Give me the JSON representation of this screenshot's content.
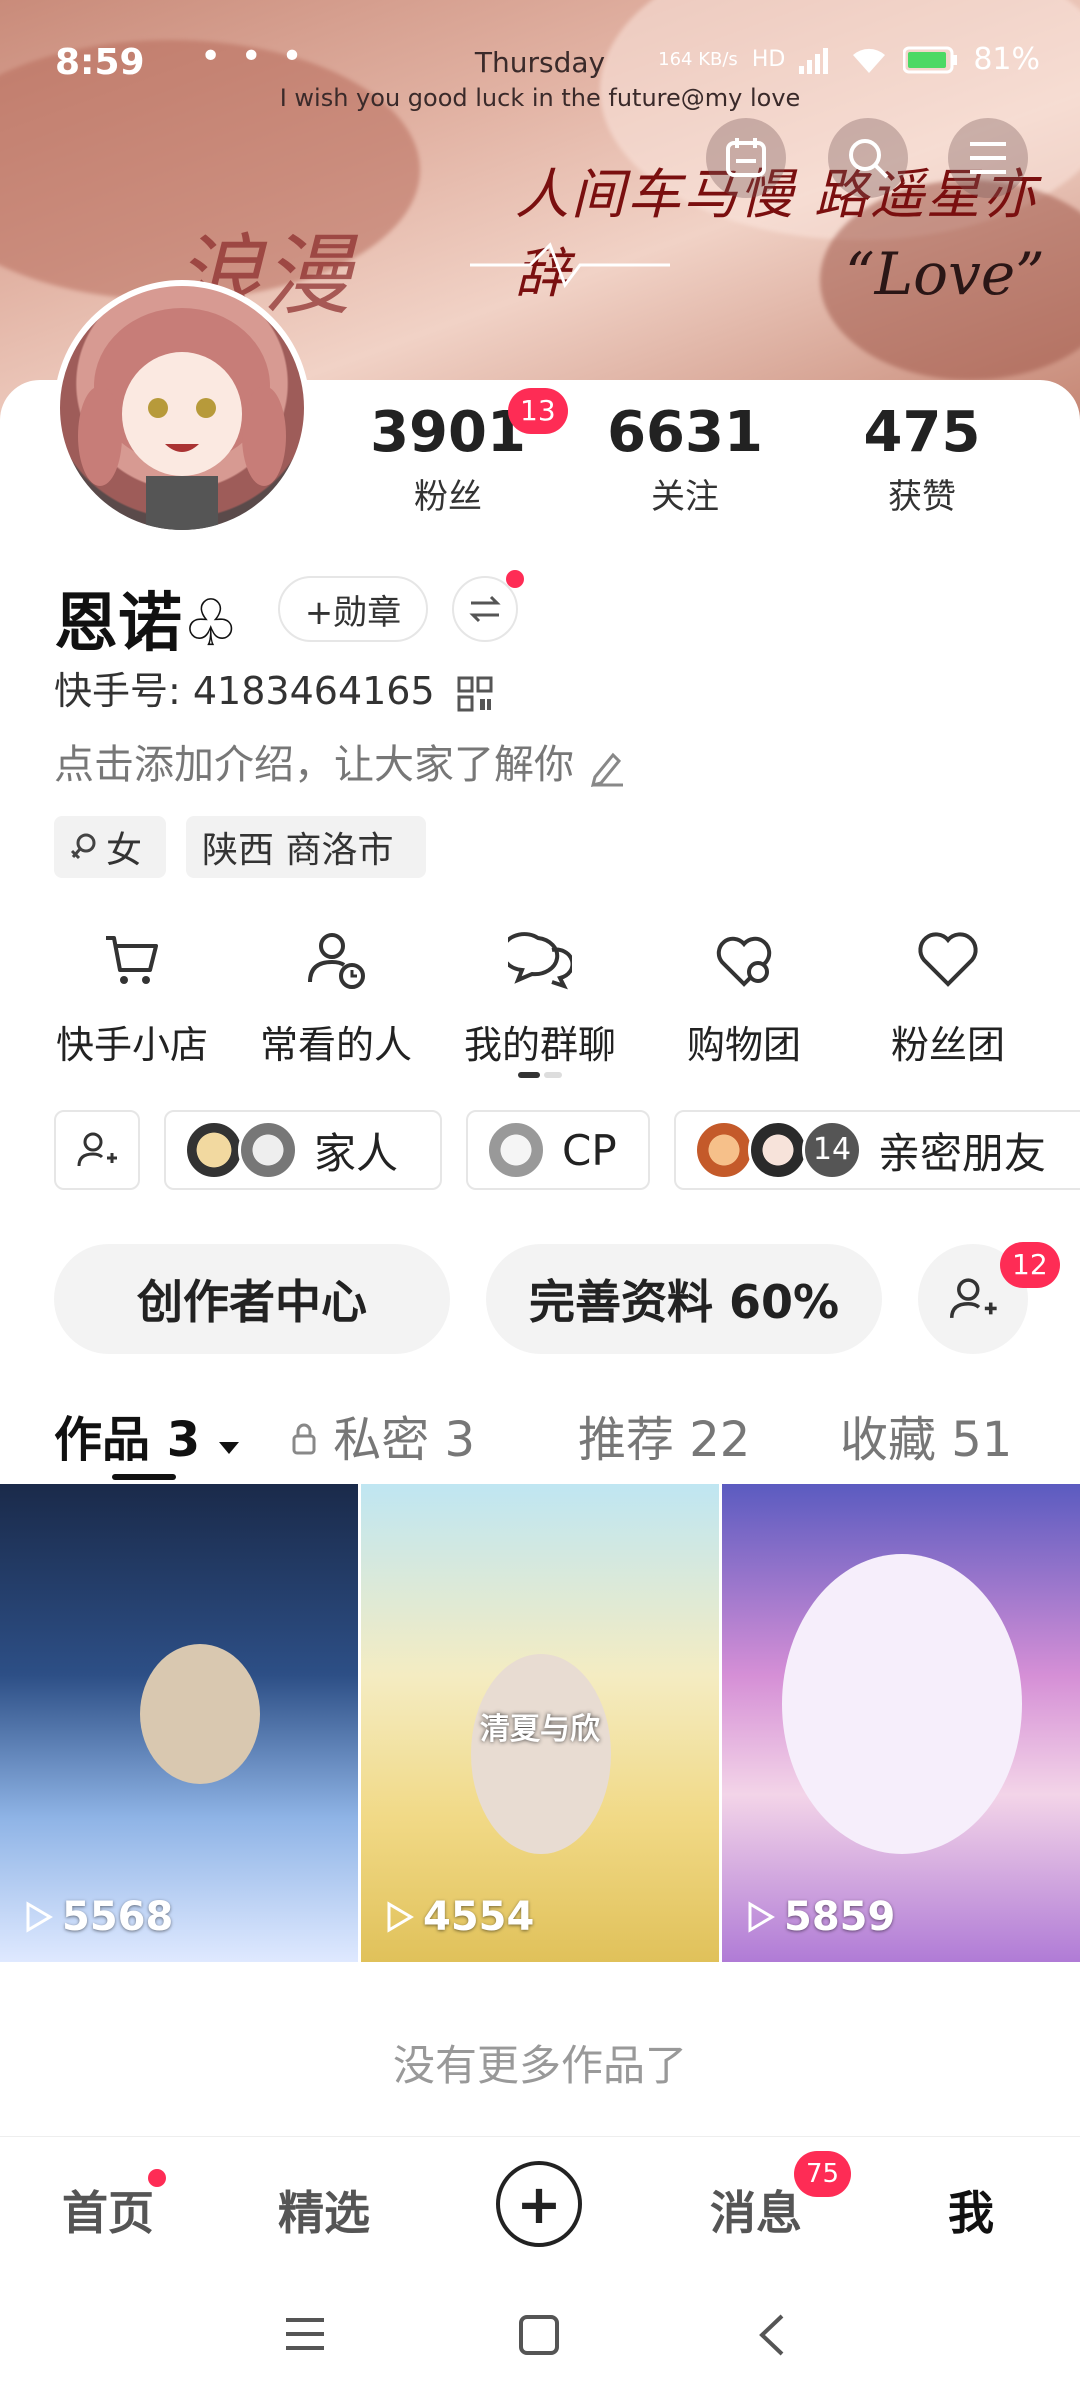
{
  "status_bar": {
    "time": "8:59",
    "day": "Thursday",
    "motto": "I wish you good luck in the future@my love",
    "net_speed": "164 KB/s",
    "network": "HD",
    "battery": "81%"
  },
  "banner": {
    "calligraphy_left": "浪漫",
    "calligraphy_right": "人间车马慢 路遥星亦辞",
    "love_text": "“Love”"
  },
  "profile": {
    "name": "恩诺",
    "name_suit": "♧",
    "medal_label": "+勋章",
    "uid_label": "快手号: 4183464165",
    "intro": "点击添加介绍，让大家了解你",
    "gender_tag": "女",
    "location_tag": "陕西 商洛市"
  },
  "stats": [
    {
      "value": "3901",
      "label": "粉丝",
      "badge": "13"
    },
    {
      "value": "6631",
      "label": "关注"
    },
    {
      "value": "475",
      "label": "获赞"
    }
  ],
  "services": [
    {
      "label": "快手小店",
      "icon": "cart-icon"
    },
    {
      "label": "常看的人",
      "icon": "person-clock-icon"
    },
    {
      "label": "我的群聊",
      "icon": "chat-bubbles-icon"
    },
    {
      "label": "购物团",
      "icon": "heart-chat-icon"
    },
    {
      "label": "粉丝团",
      "icon": "heart-icon"
    }
  ],
  "groups": [
    {
      "label": "家人"
    },
    {
      "label": "CP"
    },
    {
      "label": "亲密朋友",
      "count": "14"
    }
  ],
  "actions": {
    "creator_center": "创作者中心",
    "complete_profile": "完善资料 60%",
    "add_friend_badge": "12"
  },
  "tabs": [
    {
      "label": "作品 3",
      "active": true
    },
    {
      "label": "私密 3"
    },
    {
      "label": "推荐 22"
    },
    {
      "label": "收藏 51"
    }
  ],
  "videos": [
    {
      "plays": "5568"
    },
    {
      "plays": "4554",
      "caption": "清夏与欣"
    },
    {
      "plays": "5859"
    }
  ],
  "end_note": "没有更多作品了",
  "bottom_nav": [
    {
      "label": "首页",
      "dot": true
    },
    {
      "label": "精选"
    },
    {
      "label": "+"
    },
    {
      "label": "消息",
      "badge": "75"
    },
    {
      "label": "我",
      "active": true
    }
  ],
  "colors": {
    "accent": "#fe2c55",
    "text": "#222222",
    "muted": "#777777"
  }
}
